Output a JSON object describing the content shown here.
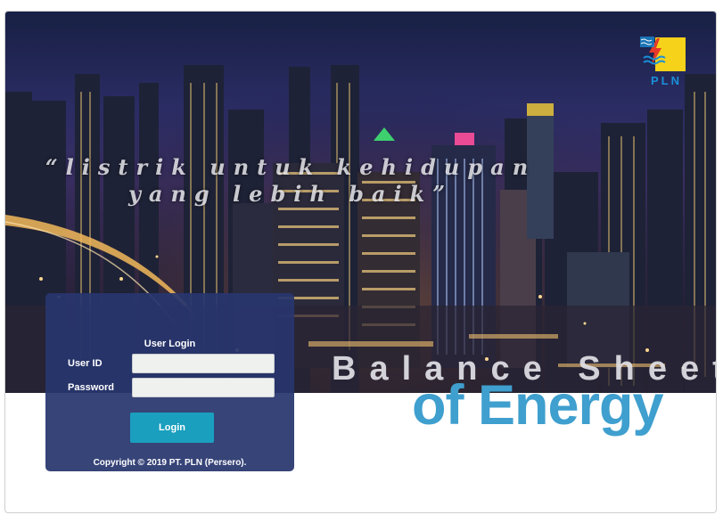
{
  "hero": {
    "tagline_line1": "“listrik untuk kehidupan",
    "tagline_line2": "yang lebih baik”"
  },
  "logo": {
    "text": "PLN"
  },
  "title": {
    "line1": "Balance Sheet",
    "line2": "of Energy"
  },
  "login": {
    "heading": "User Login",
    "user_label": "User ID",
    "user_value": "",
    "password_label": "Password",
    "password_value": "",
    "button_label": "Login",
    "copyright": "Copyright © 2019 PT. PLN (Persero)."
  },
  "colors": {
    "brand_blue": "#3f9fce",
    "button": "#1a9fbe",
    "panel": "#28366e",
    "logo_yellow": "#f6d21a"
  }
}
